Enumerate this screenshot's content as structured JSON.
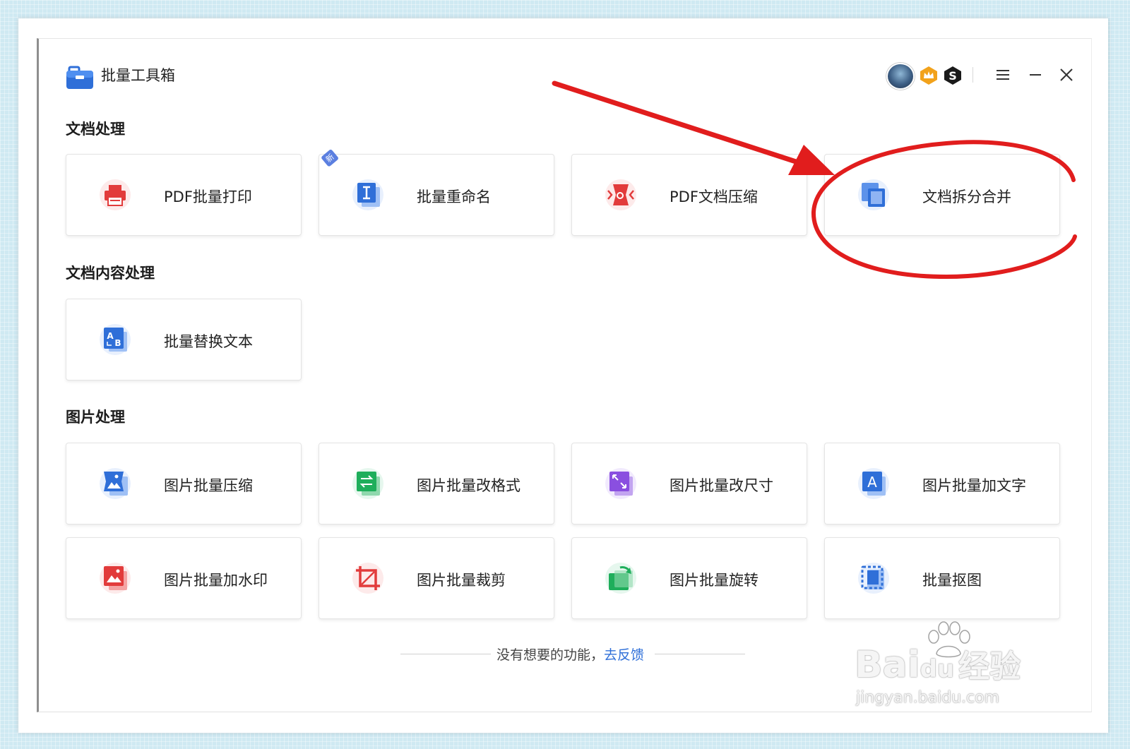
{
  "app": {
    "title": "批量工具箱"
  },
  "toolbar": {
    "avatar": "user-avatar",
    "vip": "vip-crown-icon",
    "s_badge": "s-badge-icon",
    "menu": "menu-icon",
    "minimize": "minimize-icon",
    "close": "close-icon"
  },
  "sections": {
    "doc": {
      "title": "文档处理",
      "items": [
        {
          "label": "PDF批量打印",
          "icon": "printer-icon",
          "color": "#e23b3b"
        },
        {
          "label": "批量重命名",
          "icon": "rename-icon",
          "color": "#2f6fd8",
          "tag": "新"
        },
        {
          "label": "PDF文档压缩",
          "icon": "compress-pdf-icon",
          "color": "#e23b3b"
        },
        {
          "label": "文档拆分合并",
          "icon": "split-merge-icon",
          "color": "#2f6fd8"
        }
      ]
    },
    "content": {
      "title": "文档内容处理",
      "items": [
        {
          "label": "批量替换文本",
          "icon": "replace-text-icon",
          "color": "#2f6fd8"
        }
      ]
    },
    "image": {
      "title": "图片处理",
      "items": [
        {
          "label": "图片批量压缩",
          "icon": "image-compress-icon",
          "color": "#2f6fd8"
        },
        {
          "label": "图片批量改格式",
          "icon": "image-format-icon",
          "color": "#1fae5b"
        },
        {
          "label": "图片批量改尺寸",
          "icon": "image-resize-icon",
          "color": "#8a4fe0"
        },
        {
          "label": "图片批量加文字",
          "icon": "image-text-icon",
          "color": "#2f6fd8"
        },
        {
          "label": "图片批量加水印",
          "icon": "image-watermark-icon",
          "color": "#e23b3b"
        },
        {
          "label": "图片批量裁剪",
          "icon": "image-crop-icon",
          "color": "#e23b3b"
        },
        {
          "label": "图片批量旋转",
          "icon": "image-rotate-icon",
          "color": "#1fae5b"
        },
        {
          "label": "批量抠图",
          "icon": "cutout-icon",
          "color": "#2f6fd8"
        }
      ]
    }
  },
  "feedback": {
    "text": "没有想要的功能，",
    "link": "去反馈"
  },
  "watermark": {
    "brand": "Bai",
    "brand2": "du",
    "suffix": "经验",
    "url": "jingyan.baidu.com"
  },
  "colors": {
    "annotation": "#e11d1d",
    "accent": "#2f6fd8"
  }
}
